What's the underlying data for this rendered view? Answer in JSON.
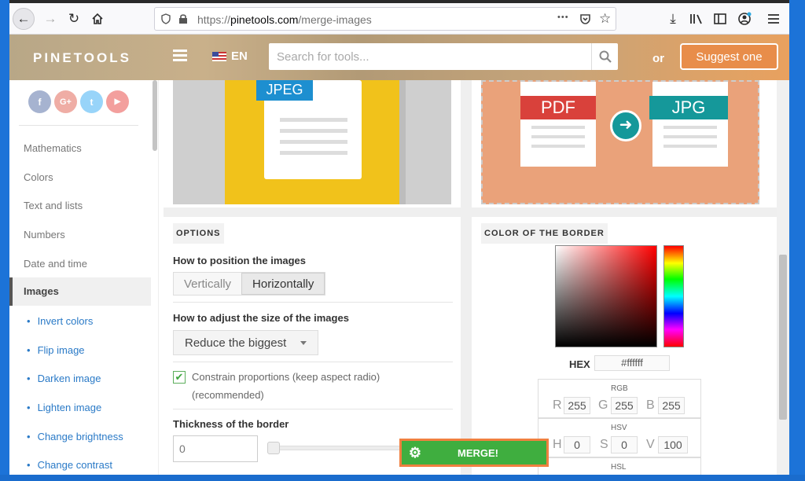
{
  "browser": {
    "url_scheme": "https://",
    "url_host": "pinetools.com",
    "url_path": "/merge-images",
    "more_label": "•••"
  },
  "header": {
    "logo": "PINETOOLS",
    "lang": "EN",
    "search_placeholder": "Search for tools...",
    "or_text": "or",
    "suggest_label": "Suggest one"
  },
  "sidebar": {
    "social": [
      "f",
      "G+",
      "t",
      "▶"
    ],
    "categories": [
      "Mathematics",
      "Colors",
      "Text and lists",
      "Numbers",
      "Date and time",
      "Images"
    ],
    "sub_items": [
      "Invert colors",
      "Flip image",
      "Darken image",
      "Lighten image",
      "Change brightness",
      "Change contrast"
    ]
  },
  "thumbs": {
    "left_format": "JPEG",
    "right_from": "PDF",
    "right_to": "JPG"
  },
  "options": {
    "title": "OPTIONS",
    "position_label": "How to position the images",
    "position_options": [
      "Vertically",
      "Horizontally"
    ],
    "size_label": "How to adjust the size of the images",
    "size_value": "Reduce the biggest",
    "constrain_label": "Constrain proportions (keep aspect radio)",
    "constrain_sub": "(recommended)",
    "constrain_checked": true,
    "border_label": "Thickness of the border",
    "border_value": "0"
  },
  "merge_label": "MERGE!",
  "color": {
    "title": "COLOR OF THE BORDER",
    "hex_label": "HEX",
    "hex_value": "#ffffff",
    "rgb_title": "RGB",
    "rgb": {
      "R": "255",
      "G": "255",
      "B": "255"
    },
    "hsv_title": "HSV",
    "hsv": {
      "H": "0",
      "S": "0",
      "V": "100"
    },
    "hsl_title": "HSL"
  }
}
